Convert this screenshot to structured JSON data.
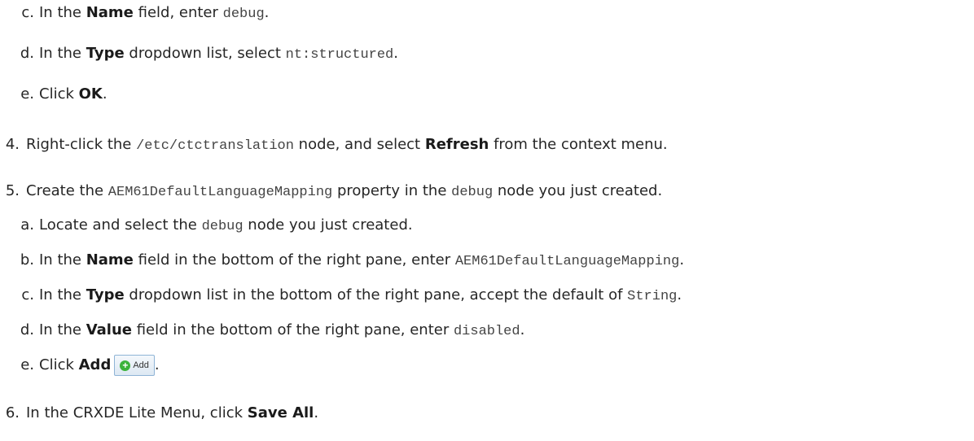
{
  "steps": {
    "c1": {
      "label": "c.",
      "pre": "In the ",
      "bold": "Name",
      "mid": " field, enter ",
      "code": "debug",
      "post": "."
    },
    "d1": {
      "label": "d.",
      "pre": "In the ",
      "bold": "Type",
      "mid": " dropdown list, select ",
      "code": "nt:structured",
      "post": "."
    },
    "e1": {
      "label": "e.",
      "pre": "Click ",
      "bold": "OK",
      "post": "."
    },
    "s4": {
      "label": "4.",
      "pre": "Right-click the ",
      "code": "/etc/ctctranslation",
      "mid": " node, and select ",
      "bold": "Refresh",
      "post": " from the context menu."
    },
    "s5": {
      "label": "5.",
      "pre": "Create the ",
      "code": "AEM61DefaultLanguageMapping",
      "mid": " property in the ",
      "code2": "debug",
      "post": " node you just created."
    },
    "a5": {
      "label": "a.",
      "pre": "Locate and select the ",
      "code": "debug",
      "post": " node you just created."
    },
    "b5": {
      "label": "b.",
      "pre": "In the ",
      "bold": "Name",
      "mid": " field in the bottom of the right pane, enter ",
      "code": "AEM61DefaultLanguageMapping",
      "post": "."
    },
    "c5": {
      "label": "c.",
      "pre": "In the ",
      "bold": "Type",
      "mid": " dropdown list in the bottom of the right pane, accept the default of ",
      "code": "String",
      "post": "."
    },
    "d5": {
      "label": "d.",
      "pre": "In the ",
      "bold": "Value",
      "mid": " field in the bottom of the right pane, enter ",
      "code": "disabled",
      "post": "."
    },
    "e5": {
      "label": "e.",
      "pre": "Click ",
      "bold": "Add",
      "button_label": "Add",
      "button_icon": "add-plus-icon",
      "post": "."
    },
    "s6": {
      "label": "6.",
      "pre": "In the CRXDE Lite Menu, click ",
      "bold": "Save All",
      "post": "."
    }
  }
}
